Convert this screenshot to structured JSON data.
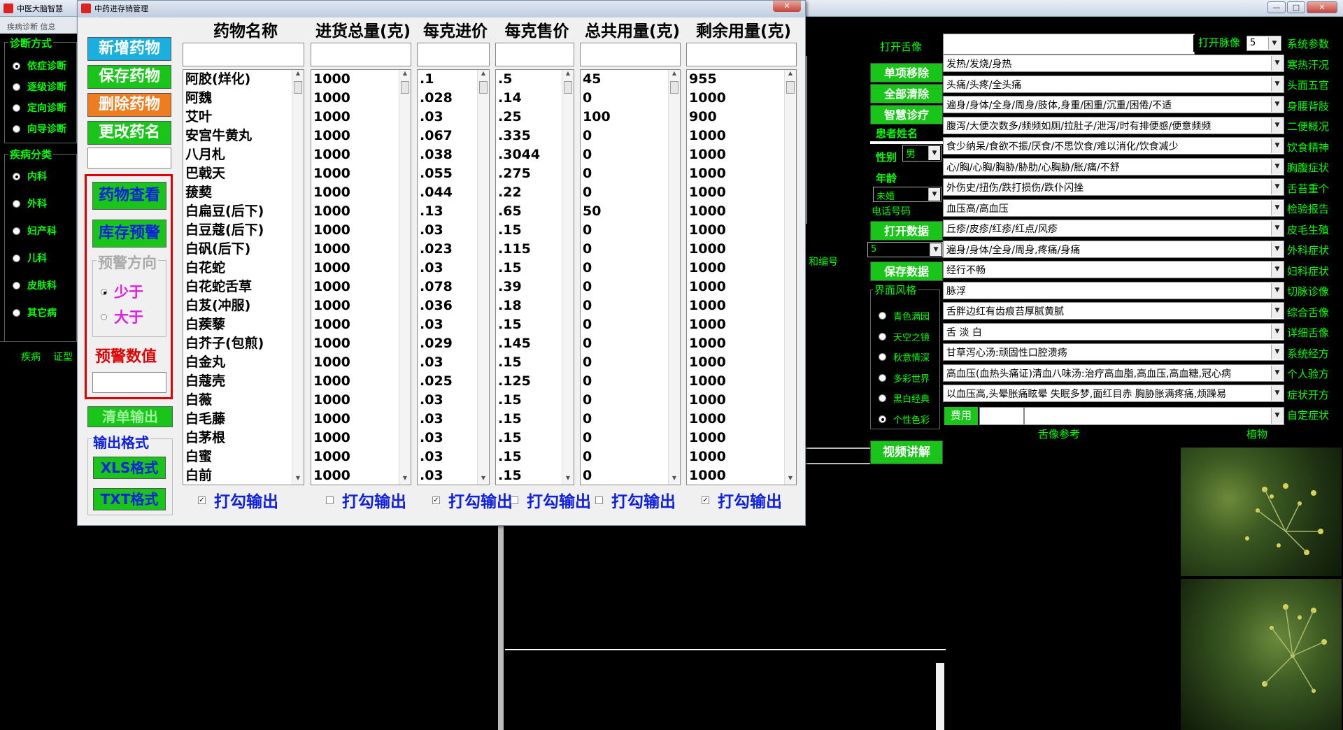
{
  "main_window": {
    "title": "中医大脑智慧",
    "menu": "疾病诊断  信息",
    "window_buttons": [
      "—",
      "□",
      "✕"
    ]
  },
  "left_panel": {
    "group1_title": "诊断方式",
    "diag_options": [
      "依症诊断",
      "逐级诊断",
      "定向诊断",
      "向导诊断"
    ],
    "group2_title": "疾病分类",
    "disease_options": [
      "内科",
      "外科",
      "妇产科",
      "儿科",
      "皮肤科",
      "其它病"
    ],
    "bottom_labels": [
      "疾病",
      "证型"
    ]
  },
  "right_panel": {
    "open_tongue": "打开舌像",
    "open_pulse": "打开脉像",
    "pulse_value": "5",
    "single_remove": "单项移除",
    "clear_all": "全部清除",
    "smart_diag": "智慧诊疗",
    "patient_name": "患者姓名",
    "gender_label": "性别",
    "gender_value": "男",
    "age_label": "年龄",
    "marital_value": "未婚",
    "phone_label": "电话号码",
    "open_data": "打开数据",
    "record_no_label": "和编号",
    "record_value": "5",
    "save_data": "保存数据",
    "theme_label": "界面风格",
    "themes": [
      "青色满园",
      "天空之镜",
      "秋意情深",
      "多彩世界",
      "黑白经典",
      "个性色彩"
    ],
    "video": "视频讲解",
    "fee_label": "费用",
    "tongue_ref": "舌像参考",
    "plant_label": "植物",
    "symptoms": [
      "发热/发烧/身热",
      "头痛/头疼/全头痛",
      "遍身/身体/全身/周身/肢体,身重/困重/沉重/困倦/不适",
      "腹泻/大便次数多/频频如厕/拉肚子/泄泻/时有排便感/便意频频",
      "食少纳呆/食欲不振/厌食/不思饮食/难以消化/饮食减少",
      "心/胸/心胸/胸胁/胁肋/心胸胁/胀/痛/不舒",
      "外伤史/扭伤/跌打损伤/跌仆闪挫",
      "血压高/高血压",
      "丘疹/皮疹/红疹/红点/风疹",
      "遍身/身体/全身/周身,疼痛/身痛",
      "经行不畅",
      "脉浮",
      "舌胖边红有齿痕苔厚腻黄腻",
      "舌 淡 白",
      "甘草泻心汤:顽固性口腔溃疡",
      "高血压(血热头痛证)清血八味汤:治疗高血脂,高血压,高血糖,冠心病",
      "以血压高,头晕胀痛眩晕 失眠多梦,面红目赤 胸胁胀满疼痛,烦躁易"
    ],
    "side_menu": [
      "系统参数",
      "寒热汗况",
      "头面五官",
      "身腰背肢",
      "二便概况",
      "饮食精神",
      "胸腹症状",
      "舌苔重个",
      "检验报告",
      "皮毛生殖",
      "外科症状",
      "妇科症状",
      "切脉诊像",
      "综合舌像",
      "详细舌像",
      "系统经方",
      "个人验方",
      "症状开方",
      "自定症状"
    ]
  },
  "dialog": {
    "title": "中药进存销管理",
    "close": "✕",
    "buttons": {
      "add": "新增药物",
      "save": "保存药物",
      "delete": "删除药物",
      "rename": "更改药名",
      "view": "药物查看",
      "stock_warn": "库存预警",
      "warn_dir": "预警方向",
      "less": "少于",
      "more": "大于",
      "warn_value": "预警数值",
      "list_out": "清单输出",
      "out_format": "输出格式",
      "xls": "XLS格式",
      "txt": "TXT格式"
    },
    "columns": [
      "药物名称",
      "进货总量(克)",
      "每克进价",
      "每克售价",
      "总共用量(克)",
      "剩余用量(克)"
    ],
    "check_label": "打勾输出",
    "checks": [
      true,
      false,
      true,
      false,
      false,
      true
    ],
    "rows": [
      [
        "阿胶(烊化)",
        "1000",
        ".1",
        ".5",
        "45",
        "955"
      ],
      [
        "阿魏",
        "1000",
        ".028",
        ".14",
        "0",
        "1000"
      ],
      [
        "艾叶",
        "1000",
        ".03",
        ".25",
        "100",
        "900"
      ],
      [
        "安宫牛黄丸",
        "1000",
        ".067",
        ".335",
        "0",
        "1000"
      ],
      [
        "八月札",
        "1000",
        ".038",
        ".3044",
        "0",
        "1000"
      ],
      [
        "巴戟天",
        "1000",
        ".055",
        ".275",
        "0",
        "1000"
      ],
      [
        "菝葜",
        "1000",
        ".044",
        ".22",
        "0",
        "1000"
      ],
      [
        "白扁豆(后下)",
        "1000",
        ".13",
        ".65",
        "50",
        "1000"
      ],
      [
        "白豆蔻(后下)",
        "1000",
        ".03",
        ".15",
        "0",
        "1000"
      ],
      [
        "白矾(后下)",
        "1000",
        ".023",
        ".115",
        "0",
        "1000"
      ],
      [
        "白花蛇",
        "1000",
        ".03",
        ".15",
        "0",
        "1000"
      ],
      [
        "白花蛇舌草",
        "1000",
        ".078",
        ".39",
        "0",
        "1000"
      ],
      [
        "白芨(冲服)",
        "1000",
        ".036",
        ".18",
        "0",
        "1000"
      ],
      [
        "白蒺藜",
        "1000",
        ".03",
        ".15",
        "0",
        "1000"
      ],
      [
        "白芥子(包煎)",
        "1000",
        ".029",
        ".145",
        "0",
        "1000"
      ],
      [
        "白金丸",
        "1000",
        ".03",
        ".15",
        "0",
        "1000"
      ],
      [
        "白蔻壳",
        "1000",
        ".025",
        ".125",
        "0",
        "1000"
      ],
      [
        "白薇",
        "1000",
        ".03",
        ".15",
        "0",
        "1000"
      ],
      [
        "白毛藤",
        "1000",
        ".03",
        ".15",
        "0",
        "1000"
      ],
      [
        "白茅根",
        "1000",
        ".03",
        ".15",
        "0",
        "1000"
      ],
      [
        "白蜜",
        "1000",
        ".03",
        ".15",
        "0",
        "1000"
      ],
      [
        "白前",
        "1000",
        ".03",
        ".15",
        "0",
        "1000"
      ]
    ]
  },
  "colors": {
    "green": "#19c519",
    "red": "#e00000",
    "blue": "#1020e0",
    "orange": "#f07c20",
    "magenta": "#e020e0"
  }
}
